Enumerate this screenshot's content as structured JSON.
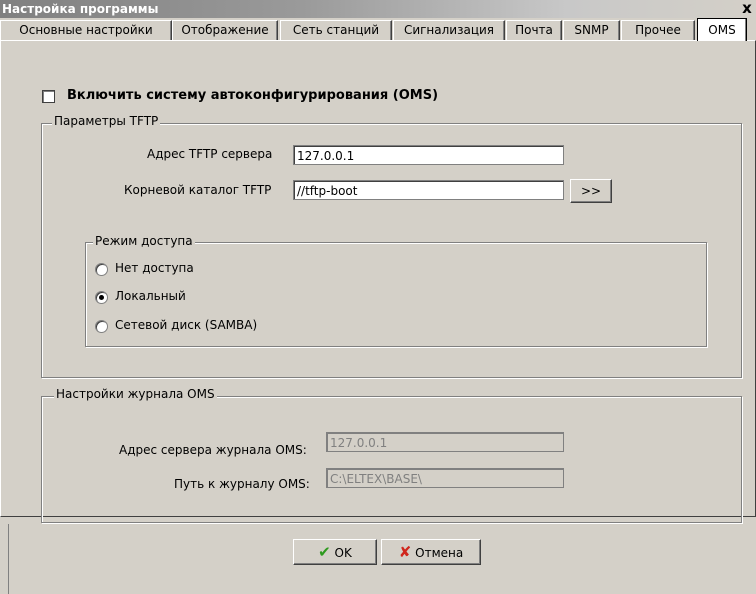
{
  "window": {
    "title": "Настройка программы",
    "close_label": "x"
  },
  "tabs": [
    {
      "label": "Основные настройки"
    },
    {
      "label": "Отображение"
    },
    {
      "label": "Сеть станций"
    },
    {
      "label": "Сигнализация"
    },
    {
      "label": "Почта"
    },
    {
      "label": "SNMP"
    },
    {
      "label": "Прочее"
    },
    {
      "label": "OMS"
    }
  ],
  "active_tab": "OMS",
  "enable_oms": {
    "label": "Включить систему автоконфигурирования (OMS)",
    "checked": false
  },
  "tftp": {
    "group_title": "Параметры TFTP",
    "server_label": "Адрес TFTP сервера",
    "server_value": "127.0.0.1",
    "root_label": "Корневой каталог TFTP",
    "root_value": "//tftp-boot",
    "browse_label": ">>"
  },
  "access": {
    "group_title": "Режим доступа",
    "options": [
      {
        "label": "Нет доступа",
        "selected": false
      },
      {
        "label": "Локальный",
        "selected": true
      },
      {
        "label": "Сетевой диск (SAMBA)",
        "selected": false
      }
    ]
  },
  "log": {
    "group_title": "Настройки журнала OMS",
    "server_label": "Адрес сервера журнала OMS:",
    "server_value": "127.0.0.1",
    "path_label": "Путь к журналу OMS:",
    "path_value": "C:\\ELTEX\\BASE\\"
  },
  "buttons": {
    "ok_label": "OK",
    "cancel_label": "Отмена"
  },
  "colors": {
    "ok_icon": "#2e9a1e",
    "cancel_icon": "#d0261c"
  }
}
